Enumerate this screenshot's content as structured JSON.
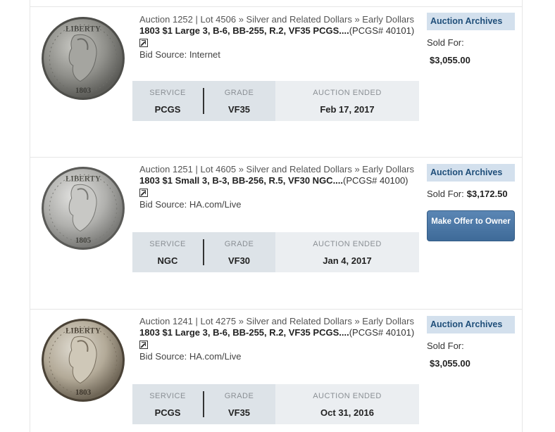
{
  "results": [
    {
      "crumb": "Auction 1252 | Lot 4506 » Silver and Related Dollars » Early Dollars",
      "title": "1803 $1 Large 3, B-6, BB-255, R.2, VF35 PCGS....",
      "cert": "(PCGS# 40101)",
      "bid_source": "Bid Source: Internet",
      "service_label": "SERVICE",
      "service": "PCGS",
      "grade_label": "GRADE",
      "grade": "VF35",
      "ended_label": "AUCTION ENDED",
      "ended": "Feb 17, 2017",
      "archive": "Auction Archives",
      "sold_label": "Sold For:",
      "price": "$3,055.00",
      "coin_date": "1803",
      "coin_tone": "gray"
    },
    {
      "crumb": "Auction 1251 | Lot 4605 » Silver and Related Dollars » Early Dollars",
      "title": "1803 $1 Small 3, B-3, BB-256, R.5, VF30 NGC....",
      "cert": "(PCGS# 40100)",
      "bid_source": "Bid Source: HA.com/Live",
      "service_label": "SERVICE",
      "service": "NGC",
      "grade_label": "GRADE",
      "grade": "VF30",
      "ended_label": "AUCTION ENDED",
      "ended": "Jan 4, 2017",
      "archive": "Auction Archives",
      "sold_label": "Sold For:",
      "price": "$3,172.50",
      "offer": "Make Offer to Owner",
      "coin_date": "1805",
      "coin_tone": "silver"
    },
    {
      "crumb": "Auction 1241 | Lot 4275 » Silver and Related Dollars » Early Dollars",
      "title": "1803 $1 Large 3, B-6, BB-255, R.2, VF35 PCGS....",
      "cert": "(PCGS# 40101)",
      "bid_source": "Bid Source: HA.com/Live",
      "service_label": "SERVICE",
      "service": "PCGS",
      "grade_label": "GRADE",
      "grade": "VF35",
      "ended_label": "AUCTION ENDED",
      "ended": "Oct 31, 2016",
      "archive": "Auction Archives",
      "sold_label": "Sold For:",
      "price": "$3,055.00",
      "coin_date": "1803",
      "coin_tone": "warm"
    }
  ],
  "coin_word": "LIBERTY",
  "colors": {
    "archive_bg": "#d3e0ed",
    "archive_text": "#1f4e79",
    "button": "#4a76a4"
  }
}
